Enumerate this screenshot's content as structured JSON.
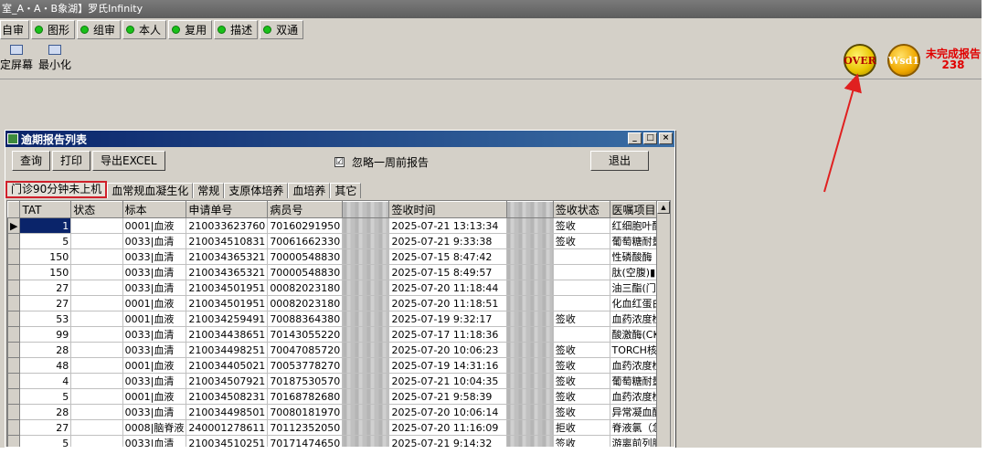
{
  "app": {
    "title": "室_A・A・B象湖】罗氏Infinity"
  },
  "toolbar": [
    {
      "label": "自审",
      "dot": false
    },
    {
      "label": "图形",
      "dot": true
    },
    {
      "label": "组审",
      "dot": true
    },
    {
      "label": "本人",
      "dot": true
    },
    {
      "label": "复用",
      "dot": true
    },
    {
      "label": "描述",
      "dot": true
    },
    {
      "label": "双通",
      "dot": true
    }
  ],
  "iconbar": {
    "lock_screen": "定屏幕",
    "minimize": "最小化"
  },
  "status_buttons": {
    "over": "OVER",
    "wsd": "Wsd1"
  },
  "unfinished": {
    "label": "未完成报告",
    "count": "238"
  },
  "window": {
    "title": "逾期报告列表",
    "buttons": {
      "query": "查询",
      "print": "打印",
      "export": "导出EXCEL",
      "exit": "退出"
    },
    "ignore_checkbox": {
      "label": "忽略一周前报告",
      "checked": "☑"
    },
    "tabs": [
      "门诊90分钟未上机",
      "血常规血凝生化",
      "常规",
      "支原体培养",
      "血培养",
      "其它"
    ],
    "columns": [
      "TAT",
      "状态",
      "标本",
      "申请单号",
      "病员号",
      "",
      "签收时间",
      "",
      "签收状态",
      "医嘱项目"
    ],
    "rows": [
      {
        "tat": "1",
        "status": "",
        "specimen": "0001|血液",
        "request": "210033623760",
        "patient": "70160291950",
        "time": "2025-07-21 13:13:34",
        "sign": "签收",
        "order": "红细胞叶酸"
      },
      {
        "tat": "5",
        "status": "",
        "specimen": "0033|血清",
        "request": "210034510831",
        "patient": "70061662330",
        "time": "2025-07-21 9:33:38",
        "sign": "签收",
        "order": "葡萄糖耐量"
      },
      {
        "tat": "150",
        "status": "",
        "specimen": "0033|血清",
        "request": "210034365321",
        "patient": "70000548830",
        "time": "2025-07-15 8:47:42",
        "sign": "",
        "order": "性磷酸酶（"
      },
      {
        "tat": "150",
        "status": "",
        "specimen": "0033|血清",
        "request": "210034365321",
        "patient": "70000548830",
        "time": "2025-07-15 8:49:57",
        "sign": "",
        "order": "肽(空腹)▮"
      },
      {
        "tat": "27",
        "status": "",
        "specimen": "0033|血清",
        "request": "210034501951",
        "patient": "00082023180",
        "time": "2025-07-20 11:18:44",
        "sign": "",
        "order": "油三酯(门"
      },
      {
        "tat": "27",
        "status": "",
        "specimen": "0001|血液",
        "request": "210034501951",
        "patient": "00082023180",
        "time": "2025-07-20 11:18:51",
        "sign": "",
        "order": "化血红蛋白"
      },
      {
        "tat": "53",
        "status": "",
        "specimen": "0001|血液",
        "request": "210034259491",
        "patient": "70088364380",
        "time": "2025-07-19 9:32:17",
        "sign": "签收",
        "order": "血药浓度检"
      },
      {
        "tat": "99",
        "status": "",
        "specimen": "0033|血清",
        "request": "210034438651",
        "patient": "70143055220",
        "time": "2025-07-17 11:18:36",
        "sign": "",
        "order": "酸激酶(CK)"
      },
      {
        "tat": "28",
        "status": "",
        "specimen": "0033|血清",
        "request": "210034498251",
        "patient": "70047085720",
        "time": "2025-07-20 10:06:23",
        "sign": "签收",
        "order": "TORCH核酸"
      },
      {
        "tat": "48",
        "status": "",
        "specimen": "0001|血液",
        "request": "210034405021",
        "patient": "70053778270",
        "time": "2025-07-19 14:31:16",
        "sign": "签收",
        "order": "血药浓度检"
      },
      {
        "tat": "4",
        "status": "",
        "specimen": "0033|血清",
        "request": "210034507921",
        "patient": "70187530570",
        "time": "2025-07-21 10:04:35",
        "sign": "签收",
        "order": "葡萄糖耐量"
      },
      {
        "tat": "5",
        "status": "",
        "specimen": "0001|血液",
        "request": "210034508231",
        "patient": "70168782680",
        "time": "2025-07-21 9:58:39",
        "sign": "签收",
        "order": "血药浓度检"
      },
      {
        "tat": "28",
        "status": "",
        "specimen": "0033|血清",
        "request": "210034498501",
        "patient": "70080181970",
        "time": "2025-07-20 10:06:14",
        "sign": "签收",
        "order": "异常凝血酶"
      },
      {
        "tat": "27",
        "status": "",
        "specimen": "0008|脑脊液",
        "request": "240001278611",
        "patient": "70112352050",
        "time": "2025-07-20 11:16:09",
        "sign": "拒收",
        "order": "脊液氯（急"
      },
      {
        "tat": "5",
        "status": "",
        "specimen": "0033|血清",
        "request": "210034510251",
        "patient": "70171474650",
        "time": "2025-07-21 9:14:32",
        "sign": "签收",
        "order": "游离前列腺"
      }
    ]
  }
}
